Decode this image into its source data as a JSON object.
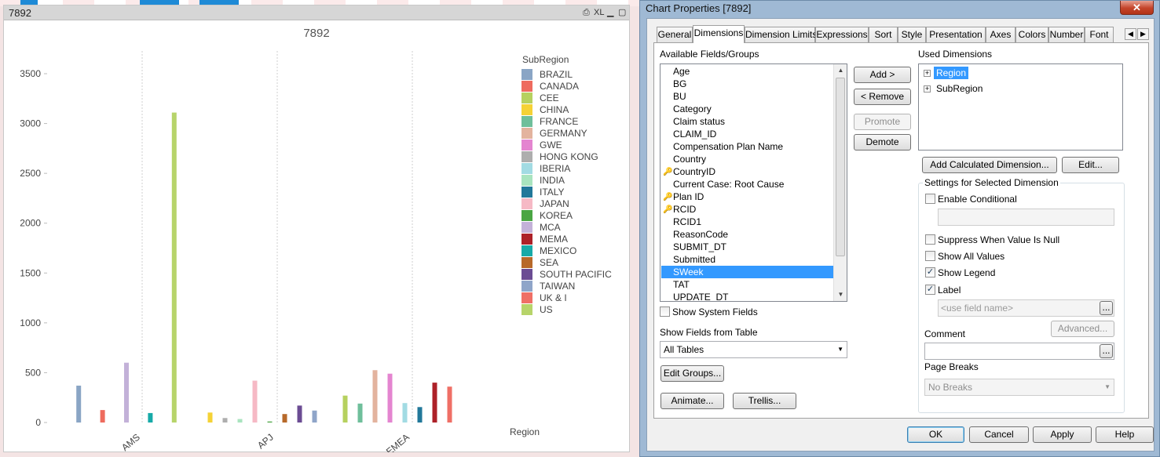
{
  "chart_window": {
    "caption": "7892",
    "icons": [
      "print-icon",
      "xl-icon",
      "minimize-icon",
      "maximize-icon"
    ],
    "xl_label": "XL",
    "title": "7892",
    "legend_title": "SubRegion",
    "xlabel": "Region"
  },
  "chart_data": {
    "type": "bar",
    "title": "7892",
    "xlabel": "Region",
    "ylabel": "",
    "categories": [
      "AMS",
      "APJ",
      "EMEA"
    ],
    "ylim": [
      0,
      3500
    ],
    "yticks": [
      0,
      500,
      1000,
      1500,
      2000,
      2500,
      3000,
      3500
    ],
    "legend_position": "right",
    "grid": "vertical dotted separators",
    "series": [
      {
        "name": "BRAZIL",
        "color": "#8aa5c5",
        "values": [
          370,
          null,
          null
        ]
      },
      {
        "name": "CANADA",
        "color": "#ee6b5e",
        "values": [
          125,
          null,
          null
        ]
      },
      {
        "name": "CEE",
        "color": "#b6d15f",
        "values": [
          null,
          null,
          270
        ]
      },
      {
        "name": "CHINA",
        "color": "#f5d236",
        "values": [
          null,
          100,
          null
        ]
      },
      {
        "name": "FRANCE",
        "color": "#6fbf9b",
        "values": [
          null,
          null,
          190
        ]
      },
      {
        "name": "GERMANY",
        "color": "#e3b39e",
        "values": [
          null,
          null,
          525
        ]
      },
      {
        "name": "GWE",
        "color": "#e485d0",
        "values": [
          null,
          null,
          490
        ]
      },
      {
        "name": "HONG KONG",
        "color": "#aeaeae",
        "values": [
          null,
          45,
          null
        ]
      },
      {
        "name": "IBERIA",
        "color": "#a2dbe3",
        "values": [
          null,
          null,
          195
        ]
      },
      {
        "name": "INDIA",
        "color": "#a9e4bf",
        "values": [
          null,
          35,
          null
        ]
      },
      {
        "name": "ITALY",
        "color": "#22789a",
        "values": [
          null,
          null,
          155
        ]
      },
      {
        "name": "JAPAN",
        "color": "#f6b9c5",
        "values": [
          null,
          420,
          null
        ]
      },
      {
        "name": "KOREA",
        "color": "#4aa543",
        "values": [
          null,
          10,
          null
        ]
      },
      {
        "name": "MCA",
        "color": "#c3b1d8",
        "values": [
          600,
          null,
          null
        ]
      },
      {
        "name": "MEMA",
        "color": "#ad2128",
        "values": [
          null,
          null,
          400
        ]
      },
      {
        "name": "MEXICO",
        "color": "#17aaa8",
        "values": [
          95,
          null,
          null
        ]
      },
      {
        "name": "SEA",
        "color": "#b7692a",
        "values": [
          null,
          85,
          null
        ]
      },
      {
        "name": "SOUTH PACIFIC",
        "color": "#6b4c93",
        "values": [
          null,
          170,
          null
        ]
      },
      {
        "name": "TAIWAN",
        "color": "#8fa5c9",
        "values": [
          null,
          120,
          null
        ]
      },
      {
        "name": "UK & I",
        "color": "#ef6f66",
        "values": [
          null,
          null,
          360
        ]
      },
      {
        "name": "US",
        "color": "#b7d46a",
        "values": [
          3110,
          null,
          null
        ]
      }
    ]
  },
  "dialog": {
    "title": "Chart Properties [7892]",
    "close_label": "✕",
    "tabs": [
      "General",
      "Dimensions",
      "Dimension Limits",
      "Expressions",
      "Sort",
      "Style",
      "Presentation",
      "Axes",
      "Colors",
      "Number",
      "Font"
    ],
    "active_tab": "Dimensions",
    "tab_scroll_left": "◀",
    "tab_scroll_right": "▶",
    "available_label": "Available Fields/Groups",
    "available_fields": [
      {
        "name": "Age",
        "key": false
      },
      {
        "name": "BG",
        "key": false
      },
      {
        "name": "BU",
        "key": false
      },
      {
        "name": "Category",
        "key": false
      },
      {
        "name": "Claim status",
        "key": false
      },
      {
        "name": "CLAIM_ID",
        "key": false
      },
      {
        "name": "Compensation Plan Name",
        "key": false
      },
      {
        "name": "Country",
        "key": false
      },
      {
        "name": "CountryID",
        "key": true
      },
      {
        "name": "Current Case: Root Cause",
        "key": false
      },
      {
        "name": "Plan ID",
        "key": true
      },
      {
        "name": "RCID",
        "key": true
      },
      {
        "name": "RCID1",
        "key": false
      },
      {
        "name": "ReasonCode",
        "key": false
      },
      {
        "name": "SUBMIT_DT",
        "key": false
      },
      {
        "name": "Submitted",
        "key": false
      },
      {
        "name": "SWeek",
        "key": false,
        "selected": true
      },
      {
        "name": "TAT",
        "key": false
      },
      {
        "name": "UPDATE_DT",
        "key": false
      }
    ],
    "key_glyph": "🔑",
    "add_button": "Add >",
    "remove_button": "< Remove",
    "promote_button": "Promote",
    "demote_button": "Demote",
    "used_label": "Used Dimensions",
    "used_dimensions": [
      {
        "name": "Region",
        "selected": true
      },
      {
        "name": "SubRegion",
        "selected": false
      }
    ],
    "tree_expand": "+",
    "add_calc_button": "Add Calculated Dimension...",
    "edit_button": "Edit...",
    "show_system_fields": "Show System Fields",
    "show_system_checked": false,
    "show_fields_label": "Show Fields from Table",
    "table_select": "All Tables",
    "edit_groups_button": "Edit Groups...",
    "animate_button": "Animate...",
    "trellis_button": "Trellis...",
    "settings_group": "Settings for Selected Dimension",
    "enable_conditional": "Enable Conditional",
    "enable_conditional_checked": false,
    "suppress_null": "Suppress When Value Is Null",
    "suppress_null_checked": false,
    "show_all_values": "Show All Values",
    "show_all_values_checked": false,
    "show_legend": "Show Legend",
    "show_legend_checked": true,
    "label": "Label",
    "label_checked": true,
    "check_glyph": "✓",
    "label_placeholder": "<use field name>",
    "ellipsis": "...",
    "advanced_button": "Advanced...",
    "comment_label": "Comment",
    "page_breaks_label": "Page Breaks",
    "page_breaks_value": "No Breaks",
    "ok_button": "OK",
    "cancel_button": "Cancel",
    "apply_button": "Apply",
    "help_button": "Help"
  }
}
